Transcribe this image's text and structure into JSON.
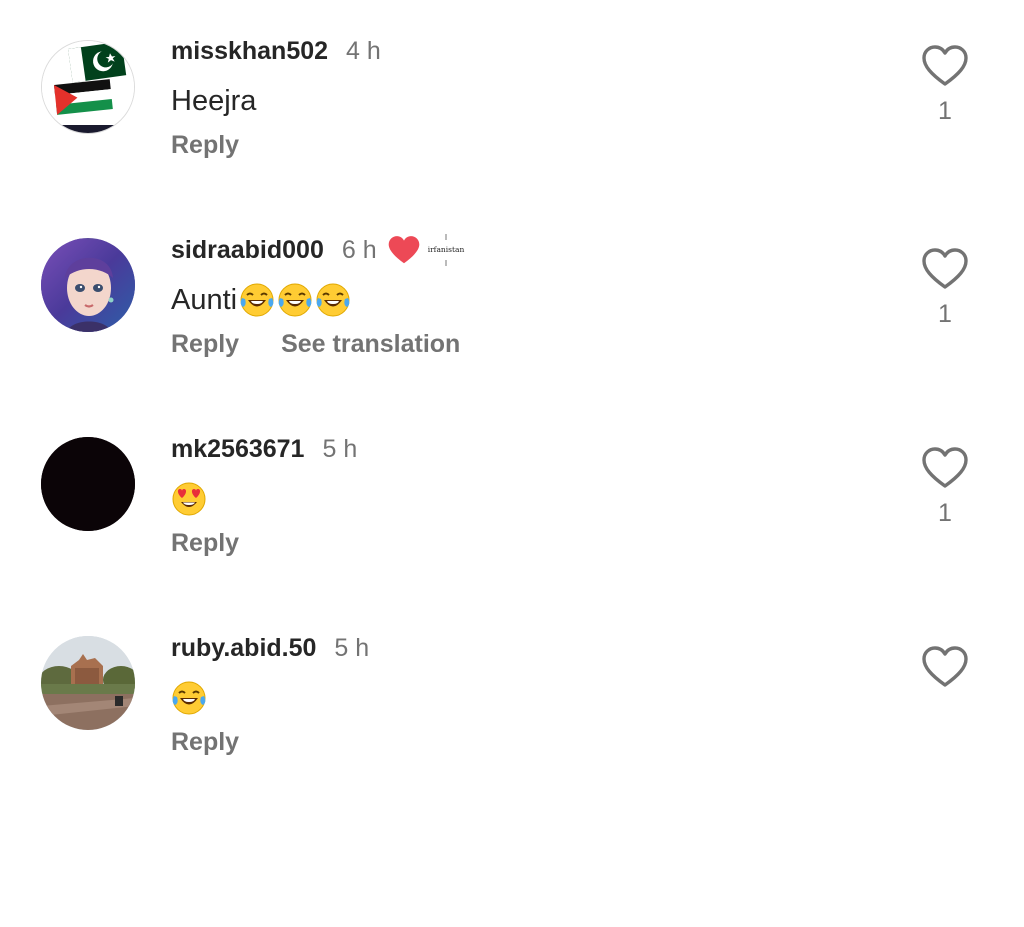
{
  "comments": [
    {
      "username": "misskhan502",
      "time": "4 h",
      "text": "Heejra",
      "emojis": [],
      "reply_label": "Reply",
      "translate_label": "",
      "like_count": "1",
      "avatar": "flags-avatar",
      "creator_liked": false
    },
    {
      "username": "sidraabid000",
      "time": "6 h",
      "text": "Aunti",
      "emojis": [
        "tears-of-joy-emoji",
        "tears-of-joy-emoji",
        "tears-of-joy-emoji"
      ],
      "reply_label": "Reply",
      "translate_label": "See translation",
      "like_count": "1",
      "avatar": "anime-girl-avatar",
      "creator_liked": true,
      "creator_badge_text": "irfanistan"
    },
    {
      "username": "mk2563671",
      "time": "5 h",
      "text": "",
      "emojis": [
        "heart-eyes-emoji"
      ],
      "reply_label": "Reply",
      "translate_label": "",
      "like_count": "1",
      "avatar": "black-avatar",
      "creator_liked": false
    },
    {
      "username": "ruby.abid.50",
      "time": "5 h",
      "text": "",
      "emojis": [
        "tears-of-joy-emoji"
      ],
      "reply_label": "Reply",
      "translate_label": "",
      "like_count": "",
      "avatar": "building-photo-avatar",
      "creator_liked": false
    }
  ],
  "colors": {
    "text_primary": "#262626",
    "text_secondary": "#737373",
    "creator_heart": "#ed4956"
  }
}
